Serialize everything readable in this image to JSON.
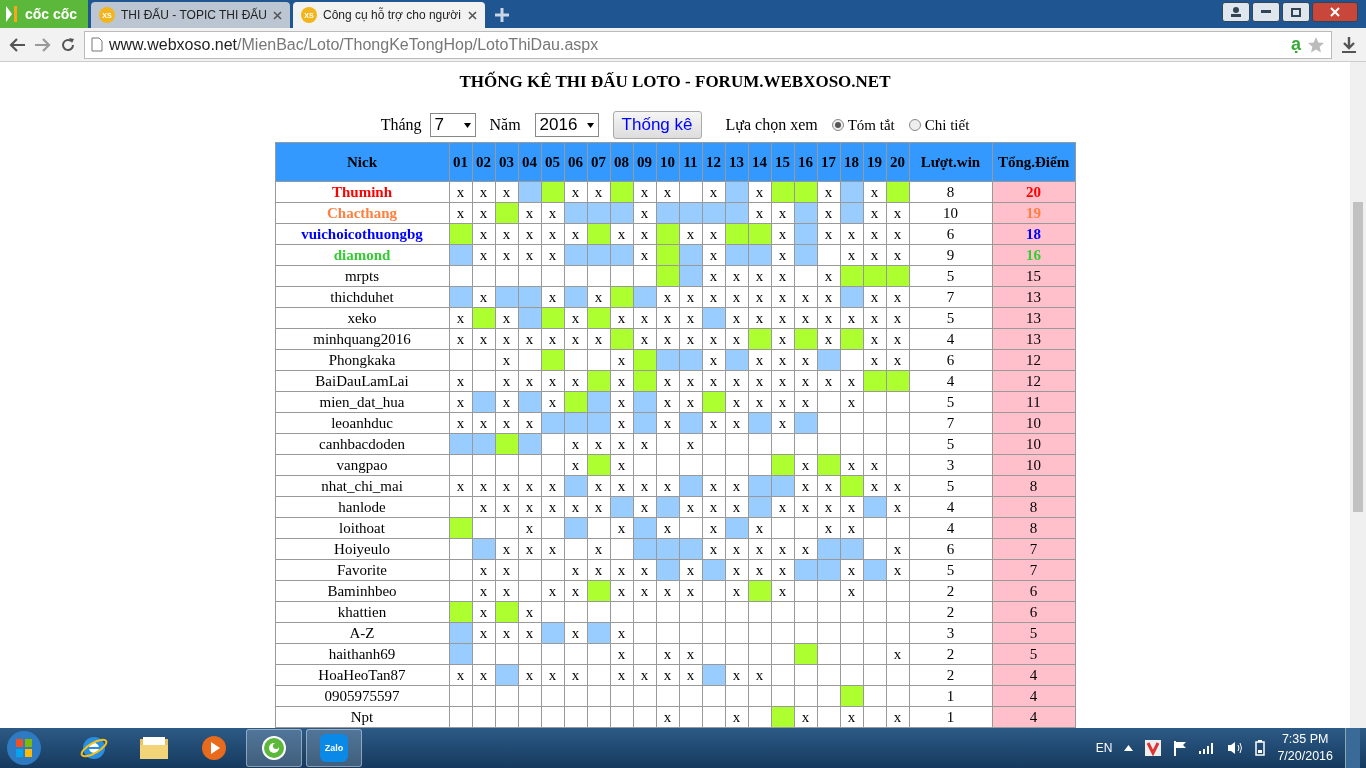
{
  "browser": {
    "logo": "cốc cốc",
    "tabs": [
      {
        "favicon": "XS",
        "title": "THI ĐẤU - TOPIC THI ĐẤU",
        "selected": false
      },
      {
        "favicon": "XS",
        "title": "Công cụ hỗ trợ cho người",
        "selected": true
      }
    ],
    "url_host": "www.webxoso.net",
    "url_path": "/MienBac/Loto/ThongKeTongHop/LotoThiDau.aspx",
    "translate_glyph": "ạ"
  },
  "page": {
    "title": "THỐNG KÊ THI ĐẤU LOTO - FORUM.WEBXOSO.NET",
    "filters": {
      "month_label": "Tháng",
      "month": "7",
      "year_label": "Năm",
      "year": "2016",
      "submit": "Thống kê",
      "view_label": "Lựa chọn xem",
      "options": [
        {
          "label": "Tóm tắt",
          "selected": true
        },
        {
          "label": "Chi tiết",
          "selected": false
        }
      ]
    },
    "table": {
      "columns": [
        "Nick",
        "01",
        "02",
        "03",
        "04",
        "05",
        "06",
        "07",
        "08",
        "09",
        "10",
        "11",
        "12",
        "13",
        "14",
        "15",
        "16",
        "17",
        "18",
        "19",
        "20",
        "Lượt.win",
        "Tổng.Điểm"
      ],
      "rows": [
        {
          "cells": [
            {
              "text": "Thuminh",
              "color": "#ff0000"
            },
            {
              "text": "x"
            },
            {
              "text": "x"
            },
            {
              "text": "x"
            },
            {
              "color": "#99ccff"
            },
            {
              "color": "#adff2f"
            },
            {
              "text": "x"
            },
            {
              "text": "x"
            },
            {
              "color": "#adff2f"
            },
            {
              "text": "x"
            },
            {
              "text": "x"
            },
            {},
            {
              "text": "x"
            },
            {
              "color": "#99ccff"
            },
            {
              "text": "x"
            },
            {
              "color": "#adff2f"
            },
            {
              "color": "#adff2f"
            },
            {
              "text": "x"
            },
            {
              "color": "#99ccff"
            },
            {
              "text": "x"
            },
            {
              "color": "#adff2f"
            },
            {
              "text": "8"
            },
            {
              "text": "20",
              "color": "#ff0000"
            }
          ]
        },
        {
          "cells": [
            {
              "text": "Chacthang",
              "color": "#ff7f3f"
            },
            {
              "text": "x"
            },
            {
              "text": "x"
            },
            {
              "color": "#adff2f"
            },
            {
              "text": "x"
            },
            {
              "text": "x"
            },
            {
              "color": "#99ccff"
            },
            {
              "color": "#99ccff"
            },
            {
              "color": "#99ccff"
            },
            {
              "text": "x"
            },
            {
              "color": "#99ccff"
            },
            {
              "color": "#99ccff"
            },
            {
              "color": "#99ccff"
            },
            {
              "color": "#99ccff"
            },
            {
              "text": "x"
            },
            {
              "text": "x"
            },
            {
              "color": "#99ccff"
            },
            {
              "text": "x"
            },
            {
              "color": "#99ccff"
            },
            {
              "text": "x"
            },
            {
              "text": "x"
            },
            {
              "text": "10"
            },
            {
              "text": "19",
              "color": "#ff7f3f"
            }
          ]
        },
        {
          "cells": [
            {
              "text": "vuichoicothuongbg",
              "color": "#0000ff"
            },
            {
              "color": "#adff2f"
            },
            {
              "text": "x"
            },
            {
              "text": "x"
            },
            {
              "text": "x"
            },
            {
              "text": "x"
            },
            {
              "text": "x"
            },
            {
              "color": "#adff2f"
            },
            {
              "text": "x"
            },
            {
              "text": "x"
            },
            {
              "color": "#adff2f"
            },
            {
              "text": "x"
            },
            {
              "text": "x"
            },
            {
              "color": "#adff2f"
            },
            {
              "color": "#adff2f"
            },
            {
              "text": "x"
            },
            {
              "color": "#99ccff"
            },
            {
              "text": "x"
            },
            {
              "text": "x"
            },
            {
              "text": "x"
            },
            {
              "text": "x"
            },
            {
              "text": "6"
            },
            {
              "text": "18",
              "color": "#0000ff"
            }
          ]
        },
        {
          "cells": [
            {
              "text": "diamond",
              "color": "#33cc33"
            },
            {
              "color": "#99ccff"
            },
            {
              "text": "x"
            },
            {
              "text": "x"
            },
            {
              "text": "x"
            },
            {
              "text": "x"
            },
            {
              "color": "#99ccff"
            },
            {
              "color": "#99ccff"
            },
            {
              "color": "#99ccff"
            },
            {
              "text": "x"
            },
            {
              "color": "#adff2f"
            },
            {
              "color": "#99ccff"
            },
            {
              "text": "x"
            },
            {
              "color": "#99ccff"
            },
            {
              "color": "#99ccff"
            },
            {
              "text": "x"
            },
            {
              "color": "#99ccff"
            },
            {},
            {
              "text": "x"
            },
            {
              "text": "x"
            },
            {
              "text": "x"
            },
            {
              "text": "9"
            },
            {
              "text": "16",
              "color": "#33cc33"
            }
          ]
        },
        {
          "cells": [
            {
              "text": "mrpts"
            },
            {},
            {},
            {},
            {},
            {},
            {},
            {},
            {},
            {},
            {
              "color": "#adff2f"
            },
            {
              "color": "#99ccff"
            },
            {
              "text": "x"
            },
            {
              "text": "x"
            },
            {
              "text": "x"
            },
            {
              "text": "x"
            },
            {},
            {
              "text": "x"
            },
            {
              "color": "#adff2f"
            },
            {
              "color": "#adff2f"
            },
            {
              "color": "#adff2f"
            },
            {
              "text": "5"
            },
            {
              "text": "15"
            }
          ]
        },
        {
          "cells": [
            {
              "text": "thichduhet"
            },
            {
              "color": "#99ccff"
            },
            {
              "text": "x"
            },
            {
              "color": "#99ccff"
            },
            {
              "color": "#99ccff"
            },
            {
              "text": "x"
            },
            {
              "color": "#99ccff"
            },
            {
              "text": "x"
            },
            {
              "color": "#adff2f"
            },
            {
              "color": "#99ccff"
            },
            {
              "text": "x"
            },
            {
              "text": "x"
            },
            {
              "text": "x"
            },
            {
              "text": "x"
            },
            {
              "text": "x"
            },
            {
              "text": "x"
            },
            {
              "text": "x"
            },
            {
              "text": "x"
            },
            {
              "color": "#99ccff"
            },
            {
              "text": "x"
            },
            {
              "text": "x"
            },
            {
              "text": "7"
            },
            {
              "text": "13"
            }
          ]
        },
        {
          "cells": [
            {
              "text": "xeko"
            },
            {
              "text": "x"
            },
            {
              "color": "#adff2f"
            },
            {
              "text": "x"
            },
            {
              "color": "#99ccff"
            },
            {
              "color": "#adff2f"
            },
            {
              "text": "x"
            },
            {
              "color": "#adff2f"
            },
            {
              "text": "x"
            },
            {
              "text": "x"
            },
            {
              "text": "x"
            },
            {
              "text": "x"
            },
            {
              "color": "#99ccff"
            },
            {
              "text": "x"
            },
            {
              "text": "x"
            },
            {
              "text": "x"
            },
            {
              "text": "x"
            },
            {
              "text": "x"
            },
            {
              "text": "x"
            },
            {
              "text": "x"
            },
            {
              "text": "x"
            },
            {
              "text": "5"
            },
            {
              "text": "13"
            }
          ]
        },
        {
          "cells": [
            {
              "text": "minhquang2016"
            },
            {
              "text": "x"
            },
            {
              "text": "x"
            },
            {
              "text": "x"
            },
            {
              "text": "x"
            },
            {
              "text": "x"
            },
            {
              "text": "x"
            },
            {
              "text": "x"
            },
            {
              "color": "#adff2f"
            },
            {
              "text": "x"
            },
            {
              "text": "x"
            },
            {
              "text": "x"
            },
            {
              "text": "x"
            },
            {
              "text": "x"
            },
            {
              "color": "#adff2f"
            },
            {
              "text": "x"
            },
            {
              "color": "#adff2f"
            },
            {
              "text": "x"
            },
            {
              "color": "#adff2f"
            },
            {
              "text": "x"
            },
            {
              "text": "x"
            },
            {
              "text": "4"
            },
            {
              "text": "13"
            }
          ]
        },
        {
          "cells": [
            {
              "text": "Phongkaka"
            },
            {},
            {},
            {
              "text": "x"
            },
            {},
            {
              "color": "#adff2f"
            },
            {},
            {},
            {
              "text": "x"
            },
            {
              "color": "#adff2f"
            },
            {
              "color": "#99ccff"
            },
            {
              "color": "#99ccff"
            },
            {
              "text": "x"
            },
            {
              "color": "#99ccff"
            },
            {
              "text": "x"
            },
            {
              "text": "x"
            },
            {
              "text": "x"
            },
            {
              "color": "#99ccff"
            },
            {},
            {
              "text": "x"
            },
            {
              "text": "x"
            },
            {
              "text": "6"
            },
            {
              "text": "12"
            }
          ]
        },
        {
          "cells": [
            {
              "text": "BaiDauLamLai"
            },
            {
              "text": "x"
            },
            {},
            {
              "text": "x"
            },
            {
              "text": "x"
            },
            {
              "text": "x"
            },
            {
              "text": "x"
            },
            {
              "color": "#adff2f"
            },
            {
              "text": "x"
            },
            {
              "color": "#adff2f"
            },
            {
              "text": "x"
            },
            {
              "text": "x"
            },
            {
              "text": "x"
            },
            {
              "text": "x"
            },
            {
              "text": "x"
            },
            {
              "text": "x"
            },
            {
              "text": "x"
            },
            {
              "text": "x"
            },
            {
              "text": "x"
            },
            {
              "color": "#adff2f"
            },
            {
              "color": "#adff2f"
            },
            {
              "text": "4"
            },
            {
              "text": "12"
            }
          ]
        },
        {
          "cells": [
            {
              "text": "mien_dat_hua"
            },
            {
              "text": "x"
            },
            {
              "color": "#99ccff"
            },
            {
              "text": "x"
            },
            {
              "color": "#99ccff"
            },
            {
              "text": "x"
            },
            {
              "color": "#adff2f"
            },
            {
              "color": "#99ccff"
            },
            {
              "text": "x"
            },
            {
              "color": "#99ccff"
            },
            {
              "text": "x"
            },
            {
              "text": "x"
            },
            {
              "color": "#adff2f"
            },
            {
              "text": "x"
            },
            {
              "text": "x"
            },
            {
              "text": "x"
            },
            {
              "text": "x"
            },
            {},
            {
              "text": "x"
            },
            {},
            {},
            {
              "text": "5"
            },
            {
              "text": "11"
            }
          ]
        },
        {
          "cells": [
            {
              "text": "leoanhduc"
            },
            {
              "text": "x"
            },
            {
              "text": "x"
            },
            {
              "text": "x"
            },
            {
              "text": "x"
            },
            {
              "color": "#99ccff"
            },
            {
              "color": "#99ccff"
            },
            {
              "color": "#99ccff"
            },
            {
              "text": "x"
            },
            {
              "color": "#99ccff"
            },
            {
              "text": "x"
            },
            {
              "color": "#99ccff"
            },
            {
              "text": "x"
            },
            {
              "text": "x"
            },
            {
              "color": "#99ccff"
            },
            {
              "text": "x"
            },
            {
              "color": "#99ccff"
            },
            {},
            {},
            {},
            {},
            {
              "text": "7"
            },
            {
              "text": "10"
            }
          ]
        },
        {
          "cells": [
            {
              "text": "canhbacdoden"
            },
            {
              "color": "#99ccff"
            },
            {
              "color": "#99ccff"
            },
            {
              "color": "#adff2f"
            },
            {
              "color": "#99ccff"
            },
            {},
            {
              "text": "x"
            },
            {
              "text": "x"
            },
            {
              "text": "x"
            },
            {
              "text": "x"
            },
            {},
            {
              "text": "x"
            },
            {},
            {},
            {},
            {},
            {},
            {},
            {},
            {},
            {},
            {
              "text": "5"
            },
            {
              "text": "10"
            }
          ]
        },
        {
          "cells": [
            {
              "text": "vangpao"
            },
            {},
            {},
            {},
            {},
            {},
            {
              "text": "x"
            },
            {
              "color": "#adff2f"
            },
            {
              "text": "x"
            },
            {},
            {},
            {},
            {},
            {},
            {},
            {
              "color": "#adff2f"
            },
            {
              "text": "x"
            },
            {
              "color": "#adff2f"
            },
            {
              "text": "x"
            },
            {
              "text": "x"
            },
            {},
            {
              "text": "3"
            },
            {
              "text": "10"
            }
          ]
        },
        {
          "cells": [
            {
              "text": "nhat_chi_mai"
            },
            {
              "text": "x"
            },
            {
              "text": "x"
            },
            {
              "text": "x"
            },
            {
              "text": "x"
            },
            {
              "text": "x"
            },
            {
              "color": "#99ccff"
            },
            {
              "text": "x"
            },
            {
              "text": "x"
            },
            {
              "text": "x"
            },
            {
              "text": "x"
            },
            {
              "color": "#99ccff"
            },
            {
              "text": "x"
            },
            {
              "text": "x"
            },
            {
              "color": "#99ccff"
            },
            {
              "color": "#99ccff"
            },
            {
              "text": "x"
            },
            {
              "text": "x"
            },
            {
              "color": "#adff2f"
            },
            {
              "text": "x"
            },
            {
              "text": "x"
            },
            {
              "text": "5"
            },
            {
              "text": "8"
            }
          ]
        },
        {
          "cells": [
            {
              "text": "hanlode"
            },
            {},
            {
              "text": "x"
            },
            {
              "text": "x"
            },
            {
              "text": "x"
            },
            {
              "text": "x"
            },
            {
              "text": "x"
            },
            {
              "text": "x"
            },
            {
              "color": "#99ccff"
            },
            {
              "text": "x"
            },
            {
              "color": "#99ccff"
            },
            {
              "text": "x"
            },
            {
              "text": "x"
            },
            {
              "text": "x"
            },
            {
              "color": "#99ccff"
            },
            {
              "text": "x"
            },
            {
              "text": "x"
            },
            {
              "text": "x"
            },
            {
              "text": "x"
            },
            {
              "color": "#99ccff"
            },
            {
              "text": "x"
            },
            {
              "text": "4"
            },
            {
              "text": "8"
            }
          ]
        },
        {
          "cells": [
            {
              "text": "loithoat"
            },
            {
              "color": "#adff2f"
            },
            {},
            {},
            {
              "text": "x"
            },
            {},
            {
              "color": "#99ccff"
            },
            {},
            {
              "text": "x"
            },
            {
              "color": "#99ccff"
            },
            {
              "text": "x"
            },
            {},
            {
              "text": "x"
            },
            {
              "color": "#99ccff"
            },
            {
              "text": "x"
            },
            {},
            {},
            {
              "text": "x"
            },
            {
              "text": "x"
            },
            {},
            {},
            {
              "text": "4"
            },
            {
              "text": "8"
            }
          ]
        },
        {
          "cells": [
            {
              "text": "Hoiyeulo"
            },
            {},
            {
              "color": "#99ccff"
            },
            {
              "text": "x"
            },
            {
              "text": "x"
            },
            {
              "text": "x"
            },
            {},
            {
              "text": "x"
            },
            {},
            {
              "color": "#99ccff"
            },
            {
              "color": "#99ccff"
            },
            {
              "color": "#99ccff"
            },
            {
              "text": "x"
            },
            {
              "text": "x"
            },
            {
              "text": "x"
            },
            {
              "text": "x"
            },
            {
              "text": "x"
            },
            {
              "color": "#99ccff"
            },
            {
              "color": "#99ccff"
            },
            {},
            {
              "text": "x"
            },
            {
              "text": "6"
            },
            {
              "text": "7"
            }
          ]
        },
        {
          "cells": [
            {
              "text": "Favorite"
            },
            {},
            {
              "text": "x"
            },
            {
              "text": "x"
            },
            {},
            {},
            {
              "text": "x"
            },
            {
              "text": "x"
            },
            {
              "text": "x"
            },
            {
              "text": "x"
            },
            {
              "color": "#99ccff"
            },
            {
              "text": "x"
            },
            {
              "color": "#99ccff"
            },
            {
              "text": "x"
            },
            {
              "text": "x"
            },
            {
              "text": "x"
            },
            {
              "color": "#99ccff"
            },
            {
              "color": "#99ccff"
            },
            {
              "text": "x"
            },
            {
              "color": "#99ccff"
            },
            {
              "text": "x"
            },
            {
              "text": "5"
            },
            {
              "text": "7"
            }
          ]
        },
        {
          "cells": [
            {
              "text": "Baminhbeo"
            },
            {},
            {
              "text": "x"
            },
            {
              "text": "x"
            },
            {},
            {
              "text": "x"
            },
            {
              "text": "x"
            },
            {
              "color": "#adff2f"
            },
            {
              "text": "x"
            },
            {
              "text": "x"
            },
            {
              "text": "x"
            },
            {
              "text": "x"
            },
            {},
            {
              "text": "x"
            },
            {
              "color": "#adff2f"
            },
            {
              "text": "x"
            },
            {},
            {},
            {
              "text": "x"
            },
            {},
            {},
            {
              "text": "2"
            },
            {
              "text": "6"
            }
          ]
        },
        {
          "cells": [
            {
              "text": "khattien"
            },
            {
              "color": "#adff2f"
            },
            {
              "text": "x"
            },
            {
              "color": "#adff2f"
            },
            {
              "text": "x"
            },
            {},
            {},
            {},
            {},
            {},
            {},
            {},
            {},
            {},
            {},
            {},
            {},
            {},
            {},
            {},
            {},
            {
              "text": "2"
            },
            {
              "text": "6"
            }
          ]
        },
        {
          "cells": [
            {
              "text": "A-Z"
            },
            {
              "color": "#99ccff"
            },
            {
              "text": "x"
            },
            {
              "text": "x"
            },
            {
              "text": "x"
            },
            {
              "color": "#99ccff"
            },
            {
              "text": "x"
            },
            {
              "color": "#99ccff"
            },
            {
              "text": "x"
            },
            {},
            {},
            {},
            {},
            {},
            {},
            {},
            {},
            {},
            {},
            {},
            {},
            {
              "text": "3"
            },
            {
              "text": "5"
            }
          ]
        },
        {
          "cells": [
            {
              "text": "haithanh69"
            },
            {
              "color": "#99ccff"
            },
            {},
            {},
            {},
            {},
            {},
            {},
            {
              "text": "x"
            },
            {},
            {
              "text": "x"
            },
            {
              "text": "x"
            },
            {},
            {},
            {},
            {},
            {
              "color": "#adff2f"
            },
            {},
            {},
            {},
            {
              "text": "x"
            },
            {
              "text": "2"
            },
            {
              "text": "5"
            }
          ]
        },
        {
          "cells": [
            {
              "text": "HoaHeoTan87"
            },
            {
              "text": "x"
            },
            {
              "text": "x"
            },
            {
              "color": "#99ccff"
            },
            {
              "text": "x"
            },
            {
              "text": "x"
            },
            {
              "text": "x"
            },
            {},
            {
              "text": "x"
            },
            {
              "text": "x"
            },
            {
              "text": "x"
            },
            {
              "text": "x"
            },
            {
              "color": "#99ccff"
            },
            {
              "text": "x"
            },
            {
              "text": "x"
            },
            {},
            {},
            {},
            {},
            {},
            {},
            {
              "text": "2"
            },
            {
              "text": "4"
            }
          ]
        },
        {
          "cells": [
            {
              "text": "0905975597"
            },
            {},
            {},
            {},
            {},
            {},
            {},
            {},
            {},
            {},
            {},
            {},
            {},
            {},
            {},
            {},
            {},
            {},
            {
              "color": "#adff2f"
            },
            {},
            {},
            {
              "text": "1"
            },
            {
              "text": "4"
            }
          ]
        },
        {
          "cells": [
            {
              "text": "Npt"
            },
            {},
            {},
            {},
            {},
            {},
            {},
            {},
            {},
            {},
            {
              "text": "x"
            },
            {},
            {},
            {
              "text": "x"
            },
            {},
            {
              "color": "#adff2f"
            },
            {
              "text": "x"
            },
            {},
            {
              "text": "x"
            },
            {},
            {
              "text": "x"
            },
            {
              "text": "1"
            },
            {
              "text": "4"
            }
          ]
        }
      ]
    }
  },
  "taskbar": {
    "pinned": [
      {
        "kind": "ie",
        "active": false
      },
      {
        "kind": "folder",
        "active": false
      },
      {
        "kind": "media",
        "active": false
      },
      {
        "kind": "coccoc",
        "active": true
      },
      {
        "kind": "zalo",
        "label": "Zalo",
        "active": true
      }
    ],
    "language": "EN",
    "time": "7:35 PM",
    "date": "7/20/2016"
  }
}
